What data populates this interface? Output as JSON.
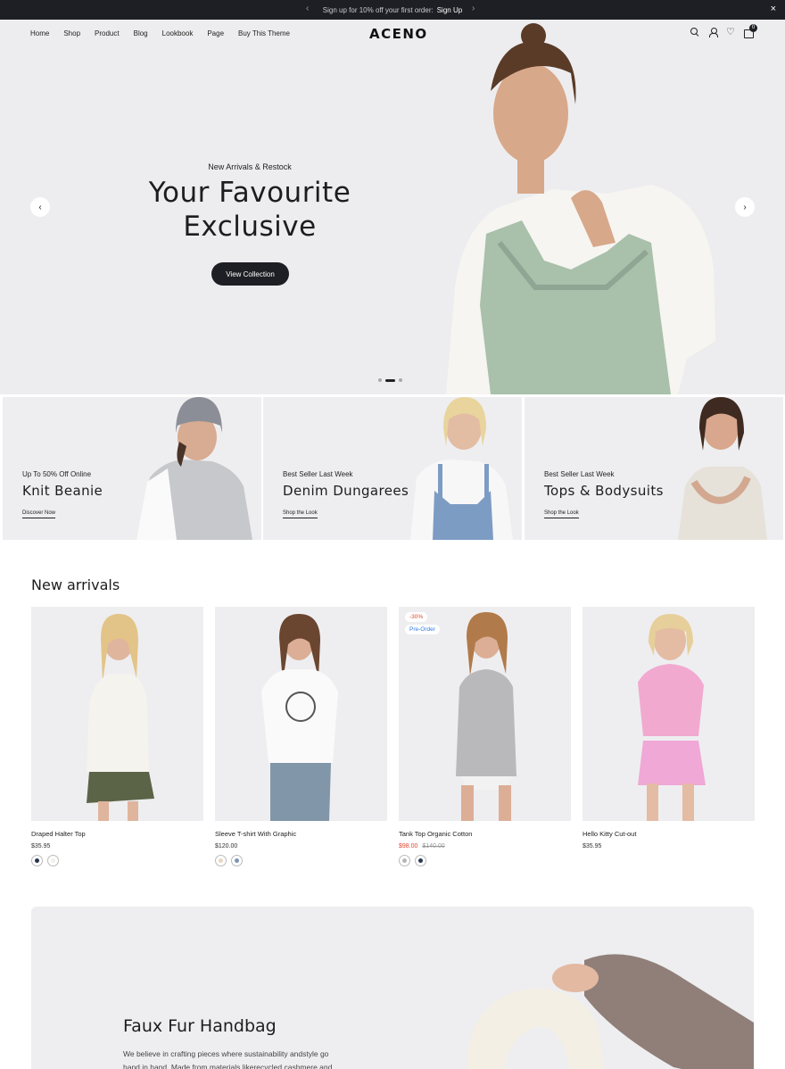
{
  "announcement": {
    "text": "Sign up for 10% off your first order:",
    "link": "Sign Up",
    "prev": "‹",
    "next": "›",
    "close": "×"
  },
  "header": {
    "logo": "ACENO",
    "nav": [
      "Home",
      "Shop",
      "Product",
      "Blog",
      "Lookbook",
      "Page",
      "Buy This Theme"
    ],
    "cart_count": "0"
  },
  "hero": {
    "subtitle": "New Arrivals & Restock",
    "title_line1": "Your Favourite",
    "title_line2": "Exclusive",
    "button": "View Collection",
    "prev": "‹",
    "next": "›",
    "active_slide": 2,
    "slide_count": 3
  },
  "promos": [
    {
      "subtitle": "Up To 50% Off Online",
      "title": "Knit Beanie",
      "link": "Discover Now"
    },
    {
      "subtitle": "Best Seller Last Week",
      "title": "Denim Dungarees",
      "link": "Shop the Look"
    },
    {
      "subtitle": "Best Seller Last Week",
      "title": "Tops & Bodysuits",
      "link": "Shop the Look"
    }
  ],
  "new_arrivals": {
    "title": "New arrivals",
    "products": [
      {
        "name": "Draped Halter Top",
        "price": "$35.95",
        "swatches": [
          "#2b3550",
          "#f2efe8"
        ]
      },
      {
        "name": "Sleeve T-shirt With Graphic",
        "price": "$120.00",
        "swatches": [
          "#e8d8c0",
          "#7d95b5"
        ]
      },
      {
        "name": "Tank Top Organic Cotton",
        "sale_price": "$98.00",
        "old_price": "$140.00",
        "badge_sale": "-30%",
        "badge_pre": "Pre-Order",
        "swatches": [
          "#b7b7b9",
          "#2d3a55"
        ]
      },
      {
        "name": "Hello Kitty Cut-out",
        "price": "$35.95",
        "swatches": []
      }
    ]
  },
  "feature": {
    "title": "Faux Fur Handbag",
    "desc_line1": "We believe in crafting pieces where sustainability andstyle go",
    "desc_line2": "hand in hand. Made from materials likerecycled cashmere and"
  }
}
